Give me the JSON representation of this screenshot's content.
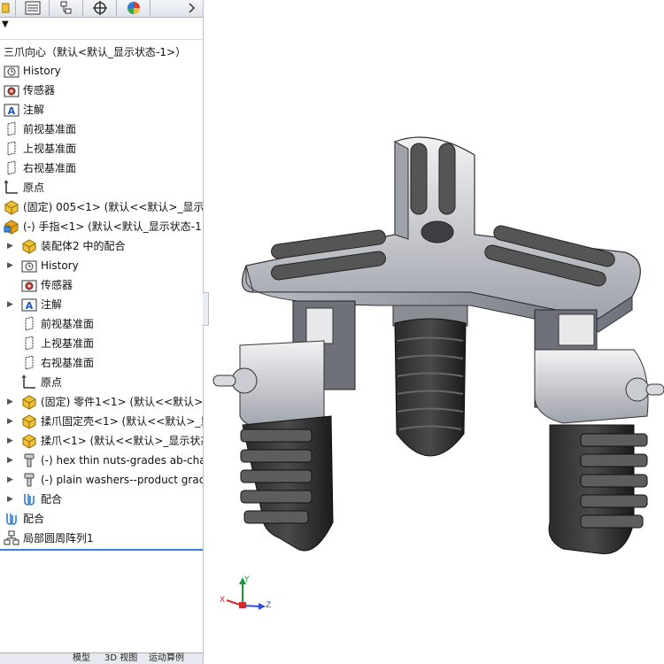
{
  "tree": {
    "root_title": "三爪向心（默认<默认_显示状态-1>）",
    "top_nodes": [
      {
        "label": "History",
        "icon": "history-folder-icon"
      },
      {
        "label": "传感器",
        "icon": "sensor-folder-icon"
      },
      {
        "label": "注解",
        "icon": "annotation-folder-icon"
      },
      {
        "label": "前视基准面",
        "icon": "plane-icon"
      },
      {
        "label": "上视基准面",
        "icon": "plane-icon"
      },
      {
        "label": "右视基准面",
        "icon": "plane-icon"
      },
      {
        "label": "原点",
        "icon": "origin-icon"
      },
      {
        "label": "(固定) 005<1> (默认<<默认>_显示状",
        "icon": "part-icon"
      },
      {
        "label": "(-) 手指<1> (默认<默认_显示状态-1>",
        "icon": "assembly-icon"
      }
    ],
    "child_nodes": [
      {
        "label": "装配体2 中的配合",
        "icon": "mates-folder-icon",
        "expandable": true
      },
      {
        "label": "History",
        "icon": "history-folder-icon",
        "expandable": true
      },
      {
        "label": "传感器",
        "icon": "sensor-folder-icon",
        "expandable": false
      },
      {
        "label": "注解",
        "icon": "annotation-folder-icon",
        "expandable": true
      },
      {
        "label": "前视基准面",
        "icon": "plane-icon",
        "expandable": false
      },
      {
        "label": "上视基准面",
        "icon": "plane-icon",
        "expandable": false
      },
      {
        "label": "右视基准面",
        "icon": "plane-icon",
        "expandable": false
      },
      {
        "label": "原点",
        "icon": "origin-icon",
        "expandable": false
      },
      {
        "label": "(固定) 零件1<1> (默认<<默认>_显",
        "icon": "part-icon",
        "expandable": true
      },
      {
        "label": "揉爪固定壳<1> (默认<<默认>_显",
        "icon": "part-icon",
        "expandable": true
      },
      {
        "label": "揉爪<1> (默认<<默认>_显示状态",
        "icon": "part-icon",
        "expandable": true
      },
      {
        "label": "(-) hex thin nuts-grades ab-cha",
        "icon": "bolt-icon",
        "expandable": true
      },
      {
        "label": "(-) plain washers--product grac",
        "icon": "bolt-icon",
        "expandable": true
      },
      {
        "label": "配合",
        "icon": "mates-icon",
        "expandable": true
      }
    ],
    "bottom_nodes": [
      {
        "label": "配合",
        "icon": "mates-icon"
      },
      {
        "label": "局部圆周阵列1",
        "icon": "pattern-icon"
      }
    ]
  },
  "bottom_tabs": [
    "模型",
    "3D 视图",
    "运动算例"
  ],
  "triad": {
    "x": "X",
    "y": "Y",
    "z": "Z"
  },
  "colors": {
    "accent": "#1f56b8",
    "part": "#f2c037",
    "assembly": "#e8a21a"
  }
}
